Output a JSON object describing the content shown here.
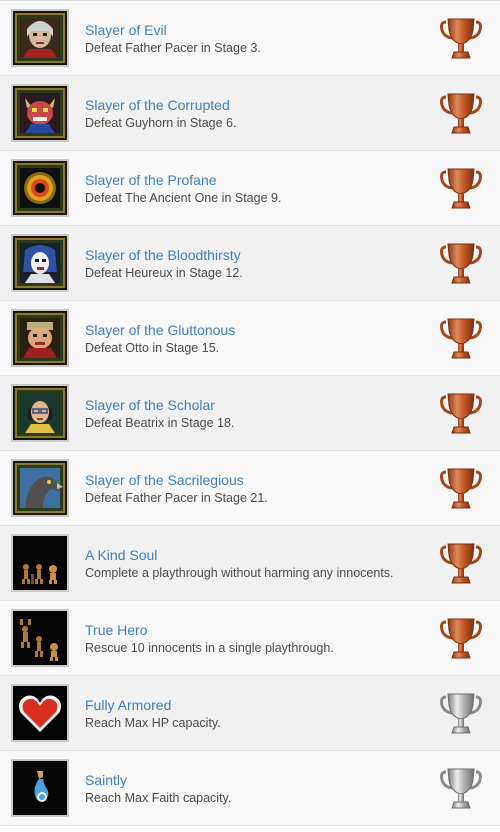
{
  "achievements": [
    {
      "title": "Slayer of Evil",
      "description": "Defeat Father Pacer in Stage 3.",
      "trophy": "bronze",
      "icon": "portrait-father-pacer-icon"
    },
    {
      "title": "Slayer of the Corrupted",
      "description": "Defeat Guyhorn in Stage 6.",
      "trophy": "bronze",
      "icon": "portrait-guyhorn-icon"
    },
    {
      "title": "Slayer of the Profane",
      "description": "Defeat The Ancient One in Stage 9.",
      "trophy": "bronze",
      "icon": "portrait-ancient-one-eye-icon"
    },
    {
      "title": "Slayer of the Bloodthirsty",
      "description": "Defeat Heureux in Stage 12.",
      "trophy": "bronze",
      "icon": "portrait-heureux-icon"
    },
    {
      "title": "Slayer of the Gluttonous",
      "description": "Defeat Otto in Stage 15.",
      "trophy": "bronze",
      "icon": "portrait-otto-icon"
    },
    {
      "title": "Slayer of the Scholar",
      "description": "Defeat Beatrix in Stage 18.",
      "trophy": "bronze",
      "icon": "portrait-beatrix-icon"
    },
    {
      "title": "Slayer of the Sacrilegious",
      "description": "Defeat Father Pacer in Stage 21.",
      "trophy": "bronze",
      "icon": "portrait-bird-icon"
    },
    {
      "title": "A Kind Soul",
      "description": "Complete a playthrough without harming any innocents.",
      "trophy": "bronze",
      "icon": "innocents-icon"
    },
    {
      "title": "True Hero",
      "description": "Rescue 10 innocents in a single playthrough.",
      "trophy": "bronze",
      "icon": "rescued-innocents-icon"
    },
    {
      "title": "Fully Armored",
      "description": "Reach Max HP capacity.",
      "trophy": "silver",
      "icon": "heart-icon"
    },
    {
      "title": "Saintly",
      "description": "Reach Max Faith capacity.",
      "trophy": "silver",
      "icon": "faith-potion-icon"
    }
  ],
  "colors": {
    "title": "#3f7fb8",
    "description": "#4a4a4a",
    "bronze": "#c8602e",
    "silver": "#a8a8a8"
  }
}
